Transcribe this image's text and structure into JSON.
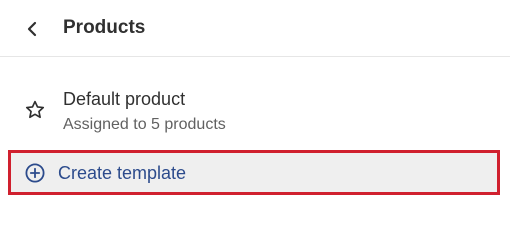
{
  "header": {
    "title": "Products",
    "back_icon": "chevron-left-icon"
  },
  "template": {
    "name": "Default product",
    "subtitle": "Assigned to 5 products",
    "icon": "star-outline-icon"
  },
  "create": {
    "label": "Create template",
    "icon": "plus-circle-icon",
    "accent_color": "#2c4b8c",
    "highlight_color": "#d0202e"
  }
}
